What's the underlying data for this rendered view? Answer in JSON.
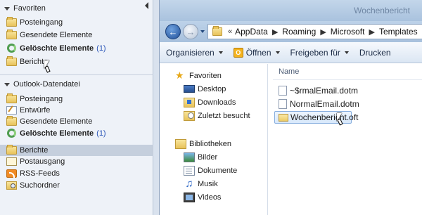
{
  "outlook": {
    "favorites": {
      "heading": "Favoriten",
      "items": [
        {
          "label": "Posteingang",
          "icon": "folder-icon"
        },
        {
          "label": "Gesendete Elemente",
          "icon": "folder-icon"
        },
        {
          "label": "Gelöschte Elemente",
          "count": "(1)",
          "bold": true,
          "icon": "recycle-icon"
        },
        {
          "label": "Berichte",
          "icon": "folder-icon"
        }
      ]
    },
    "datafile": {
      "heading": "Outlook-Datendatei",
      "items": [
        {
          "label": "Posteingang",
          "icon": "folder-icon"
        },
        {
          "label": "Entwürfe",
          "icon": "drafts-icon"
        },
        {
          "label": "Gesendete Elemente",
          "icon": "folder-icon"
        },
        {
          "label": "Gelöschte Elemente",
          "count": "(1)",
          "bold": true,
          "icon": "recycle-icon"
        },
        {
          "label": "Berichte",
          "icon": "folder-icon",
          "selected": true
        },
        {
          "label": "Postausgang",
          "icon": "outbox-icon"
        },
        {
          "label": "RSS-Feeds",
          "icon": "rss-icon"
        },
        {
          "label": "Suchordner",
          "icon": "search-folder-icon"
        }
      ]
    }
  },
  "explorer": {
    "title": "Wochenbericht",
    "address": {
      "overflow": "«",
      "segments": [
        "AppData",
        "Roaming",
        "Microsoft",
        "Templates"
      ]
    },
    "toolbar": {
      "organize": "Organisieren",
      "open": "Öffnen",
      "share": "Freigeben für",
      "print": "Drucken"
    },
    "navigation": {
      "favorites": {
        "heading": "Favoriten",
        "items": [
          "Desktop",
          "Downloads",
          "Zuletzt besucht"
        ]
      },
      "libraries": {
        "heading": "Bibliotheken",
        "items": [
          "Bilder",
          "Dokumente",
          "Musik",
          "Videos"
        ]
      }
    },
    "files": {
      "column_name": "Name",
      "items": [
        {
          "name": "~$rmalEmail.dotm",
          "icon": "document-icon"
        },
        {
          "name": "NormalEmail.dotm",
          "icon": "document-icon"
        },
        {
          "name": "Wochenbericht.oft",
          "icon": "template-icon",
          "selected": true
        }
      ]
    }
  }
}
